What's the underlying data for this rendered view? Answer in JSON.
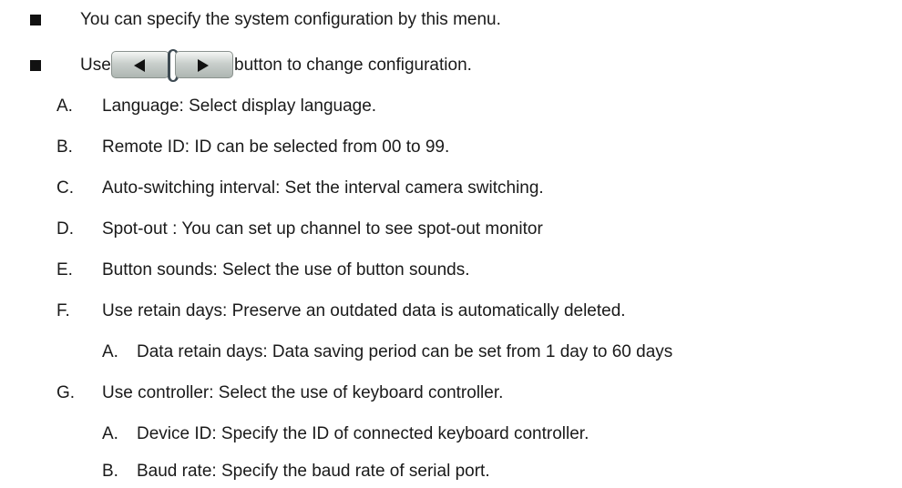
{
  "main": {
    "bullets": [
      {
        "text": "You can specify the system configuration by this menu."
      },
      {
        "prefix": "Use",
        "suffix": "button to change configuration."
      }
    ],
    "items": [
      {
        "letter": "A.",
        "text": "Language: Select display language."
      },
      {
        "letter": "B.",
        "text": "Remote ID: ID can be selected from 00 to 99."
      },
      {
        "letter": "C.",
        "text": "Auto-switching interval: Set the interval camera switching."
      },
      {
        "letter": "D.",
        "text": "Spot-out : You can set up channel to see spot-out monitor"
      },
      {
        "letter": "E.",
        "text": "Button sounds: Select the use of button sounds."
      },
      {
        "letter": "F.",
        "text": "Use retain days: Preserve an outdated data is automatically deleted."
      },
      {
        "letter": "G.",
        "text": "Use controller: Select the use of keyboard controller."
      }
    ],
    "subitems_f": [
      {
        "letter": "A.",
        "text": "Data retain days: Data saving period can be set from 1 day to 60 days"
      }
    ],
    "subitems_g": [
      {
        "letter": "A.",
        "text": "Device ID: Specify the ID of connected keyboard controller."
      },
      {
        "letter": "B.",
        "text": "Baud rate: Specify the baud rate of serial port."
      }
    ],
    "buttons": {
      "left_icon": "left-arrow-icon",
      "right_icon": "right-arrow-icon"
    }
  }
}
